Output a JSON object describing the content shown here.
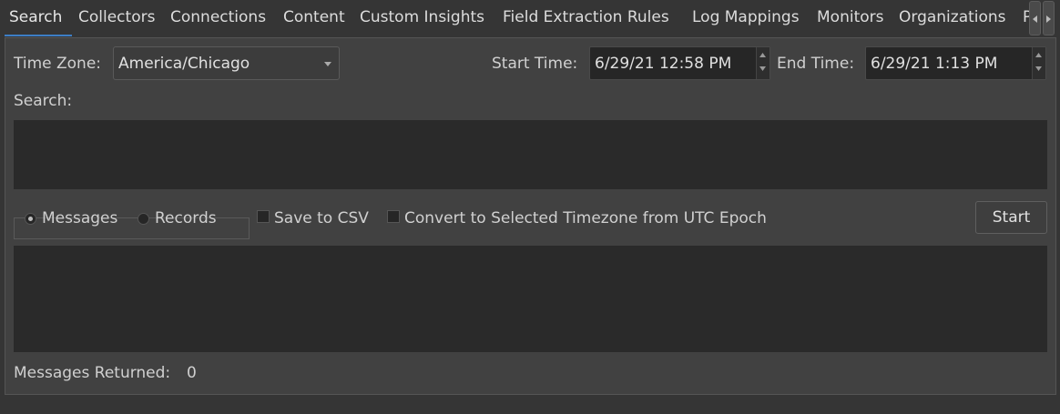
{
  "tabs": [
    "Search",
    "Collectors",
    "Connections",
    "Content",
    "Custom Insights",
    "Field Extraction Rules",
    "Log Mappings",
    "Monitors",
    "Organizations",
    "P"
  ],
  "active_tab": "Search",
  "accent_color": "#3d7ec6",
  "time_zone": {
    "label": "Time Zone:",
    "value": "America/Chicago"
  },
  "start_time": {
    "label": "Start Time:",
    "value": "6/29/21 12:58 PM"
  },
  "end_time": {
    "label": "End Time:",
    "value": "6/29/21 1:13 PM"
  },
  "search": {
    "label": "Search:",
    "value": ""
  },
  "mode": {
    "options": [
      "Messages",
      "Records"
    ],
    "selected": "Messages"
  },
  "options": {
    "save_csv": {
      "label": "Save to CSV",
      "checked": false
    },
    "convert_tz": {
      "label": "Convert to Selected Timezone from UTC Epoch",
      "checked": false
    }
  },
  "start_button": "Start",
  "results": {
    "value": ""
  },
  "status": {
    "label": "Messages Returned:",
    "count": "0"
  }
}
